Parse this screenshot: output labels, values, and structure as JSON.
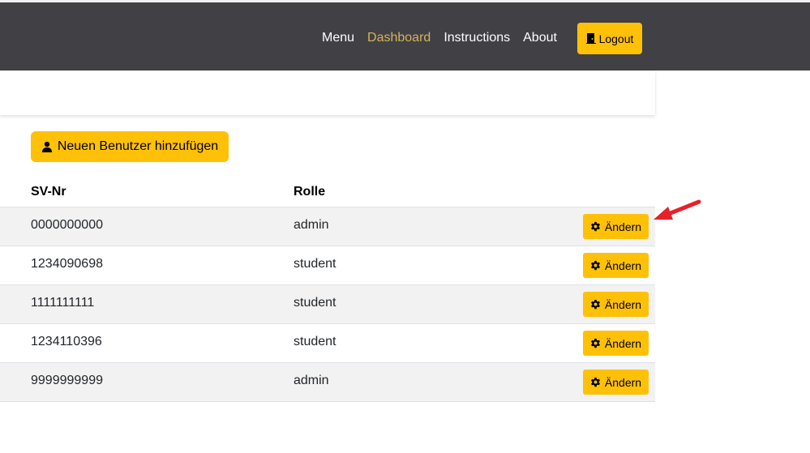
{
  "navbar": {
    "links": [
      {
        "label": "Menu",
        "active": false
      },
      {
        "label": "Dashboard",
        "active": true
      },
      {
        "label": "Instructions",
        "active": false
      },
      {
        "label": "About",
        "active": false
      }
    ],
    "logout_label": "Logout"
  },
  "actions": {
    "add_user_label": "Neuen Benutzer hinzufügen"
  },
  "table": {
    "headers": {
      "sv_nr": "SV-Nr",
      "role": "Rolle"
    },
    "edit_label": "Ändern",
    "rows": [
      {
        "sv_nr": "0000000000",
        "role": "admin"
      },
      {
        "sv_nr": "1234090698",
        "role": "student"
      },
      {
        "sv_nr": "1111111111",
        "role": "student"
      },
      {
        "sv_nr": "1234110396",
        "role": "student"
      },
      {
        "sv_nr": "9999999999",
        "role": "admin"
      }
    ]
  },
  "colors": {
    "navbar_bg": "#404045",
    "accent": "#ffc107",
    "active_link": "#d7b45a",
    "annotation_arrow": "#e8202a"
  },
  "icons": {
    "logout": "door-icon",
    "add_user": "user-icon",
    "edit": "gear-icon",
    "annotation": "red-arrow-icon"
  }
}
